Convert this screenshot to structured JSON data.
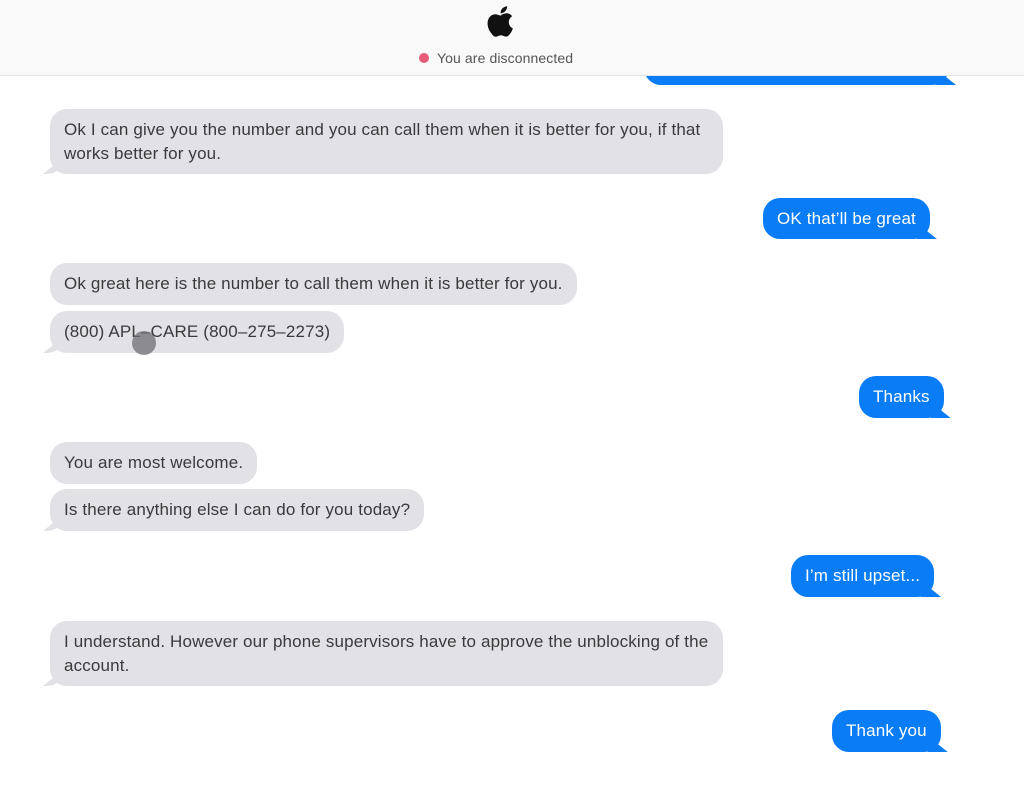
{
  "header": {
    "logo": "apple-logo-icon",
    "status_text": "You are disconnected",
    "status_color": "#e85a7a"
  },
  "colors": {
    "incoming_bubble": "#e2e2e6",
    "outgoing_bubble": "#0a7cf5"
  },
  "messages": [
    {
      "sender": "agent",
      "text": "Ok I can give you the number and you can call them when it is better for you, if that works better for you."
    },
    {
      "sender": "user",
      "text": "OK that’ll be great"
    },
    {
      "sender": "agent",
      "text": "Ok great here is the number to call them when it is better for you."
    },
    {
      "sender": "agent",
      "text": "(800) APL–CARE (800–275–2273)"
    },
    {
      "sender": "user",
      "text": "Thanks"
    },
    {
      "sender": "agent",
      "text": "You are most welcome."
    },
    {
      "sender": "agent",
      "text": "Is there anything else I can do for you today?"
    },
    {
      "sender": "user",
      "text": "I’m still upset..."
    },
    {
      "sender": "agent",
      "text": "I understand. However our phone supervisors have to approve the unblocking of the account."
    },
    {
      "sender": "user",
      "text": "Thank you"
    }
  ]
}
